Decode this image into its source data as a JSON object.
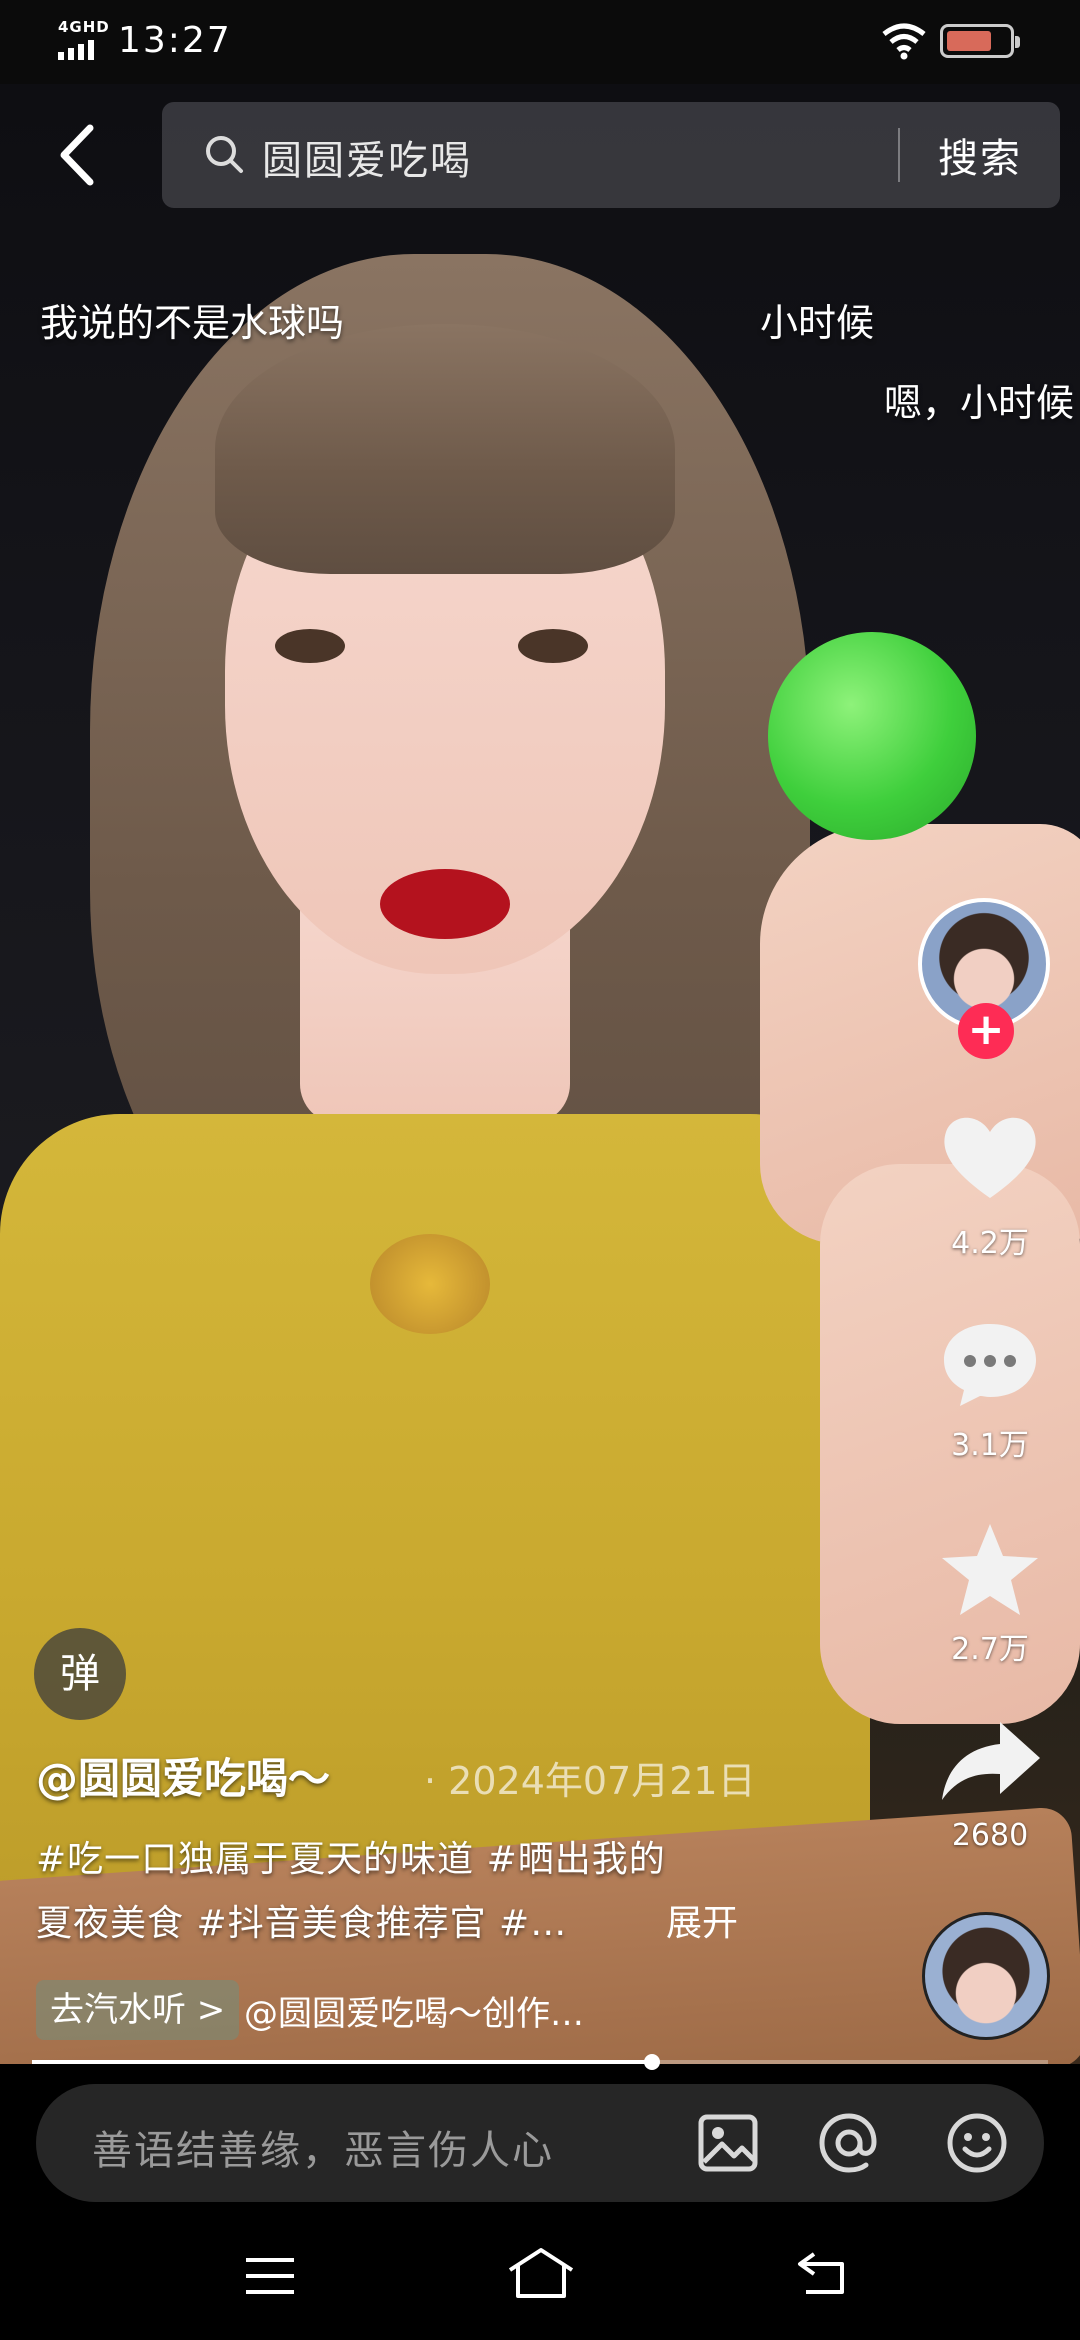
{
  "status_bar": {
    "network": "4GHD",
    "time": "13:27"
  },
  "search": {
    "query": "圆圆爱吃喝",
    "button_label": "搜索"
  },
  "danmaku": [
    "我说的不是水球吗",
    "小时候",
    "嗯，小时候"
  ],
  "actions": {
    "like_count": "4.2万",
    "comment_count": "3.1万",
    "favorite_count": "2.7万",
    "share_count": "2680"
  },
  "danmaku_button": "弹",
  "post": {
    "author": "@圆圆爱吃喝～",
    "date": "· 2024年07月21日",
    "caption_line1": "#吃一口独属于夏天的味道 #晒出我的",
    "caption_line2": "夏夜美食 #抖音美食推荐官 #…",
    "expand_label": "展开",
    "music_tag": "去汽水听 >",
    "music_credit": "@圆圆爱吃喝～创作…"
  },
  "progress": 0.61,
  "comment_bar": {
    "placeholder": "善语结善缘，恶言伤人心"
  },
  "icons": [
    "back-icon",
    "search-icon",
    "heart-icon",
    "comment-icon",
    "star-icon",
    "share-icon",
    "image-icon",
    "at-icon",
    "emoji-icon",
    "menu-icon",
    "home-icon",
    "return-icon"
  ],
  "colors": {
    "follow": "#fe2c55",
    "background": "#000000"
  }
}
